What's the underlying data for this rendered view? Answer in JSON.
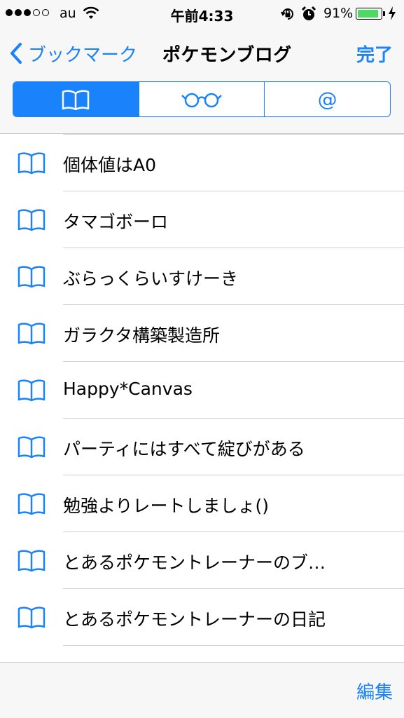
{
  "status_bar": {
    "carrier": "au",
    "signal_bars_filled": 3,
    "signal_bars_total": 5,
    "time": "午前4:33",
    "battery_percent": "91%",
    "battery_level": 0.91,
    "battery_color": "#4cd964",
    "icons": [
      "wifi-icon",
      "orientation-lock-icon",
      "alarm-icon",
      "battery-icon",
      "charging-bolt-icon"
    ]
  },
  "nav": {
    "back_label": "ブックマーク",
    "title": "ポケモンブログ",
    "done_label": "完了"
  },
  "segments": [
    {
      "icon": "book-icon",
      "selected": true
    },
    {
      "icon": "reading-glasses-icon",
      "selected": false
    },
    {
      "icon": "at-sign-icon",
      "label": "@",
      "selected": false
    }
  ],
  "bookmarks": [
    {
      "title": "個体値はA0",
      "icon": "book-icon"
    },
    {
      "title": "タマゴボーロ",
      "icon": "book-icon"
    },
    {
      "title": "ぶらっくらいすけーき",
      "icon": "book-icon"
    },
    {
      "title": "ガラクタ構築製造所",
      "icon": "book-icon"
    },
    {
      "title": "Happy*Canvas",
      "icon": "book-icon"
    },
    {
      "title": "パーティにはすべて綻びがある",
      "icon": "book-icon"
    },
    {
      "title": "勉強よりレートしましょ()",
      "icon": "book-icon"
    },
    {
      "title": "とあるポケモントレーナーのブ…",
      "icon": "book-icon"
    },
    {
      "title": "とあるポケモントレーナーの日記",
      "icon": "book-icon"
    }
  ],
  "toolbar": {
    "edit_label": "編集"
  },
  "colors": {
    "accent": "#1a82fb",
    "bar_background": "#f7f7f7",
    "separator": "#d0d0d4"
  }
}
